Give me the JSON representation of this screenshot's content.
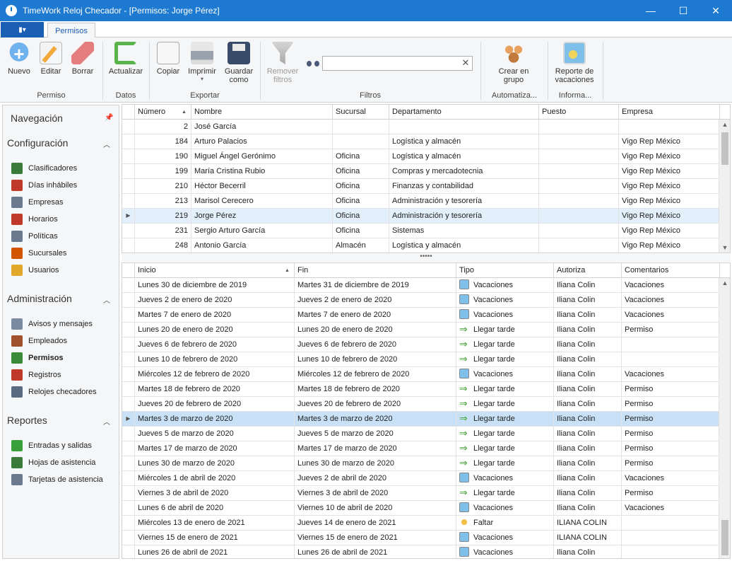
{
  "window": {
    "title": "TimeWork Reloj Checador - [Permisos: Jorge Pérez]",
    "minimize": "—",
    "maximize": "☐",
    "close": "✕"
  },
  "ribbon": {
    "app_menu_glyph": "▮▾",
    "tab": "Permisos",
    "buttons": {
      "nuevo": "Nuevo",
      "editar": "Editar",
      "borrar": "Borrar",
      "actualizar": "Actualizar",
      "copiar": "Copiar",
      "imprimir": "Imprimir",
      "guardar_1": "Guardar",
      "guardar_2": "como",
      "remover_1": "Remover",
      "remover_2": "filtros",
      "crear_1": "Crear en",
      "crear_2": "grupo",
      "reporte_1": "Reporte de",
      "reporte_2": "vacaciones"
    },
    "groups": {
      "permiso": "Permiso",
      "datos": "Datos",
      "exportar": "Exportar",
      "filtros": "Filtros",
      "automatiza": "Automatiza...",
      "informa": "Informa..."
    },
    "search": {
      "value": "",
      "placeholder": ""
    },
    "imprimir_dropdown": "▾",
    "clear_glyph": "✕"
  },
  "nav": {
    "header": "Navegación",
    "pin_glyph": "📌",
    "chevron": "︿",
    "sections": [
      {
        "title": "Configuración",
        "items": [
          "Clasificadores",
          "Días inhábiles",
          "Empresas",
          "Horarios",
          "Políticas",
          "Sucursales",
          "Usuarios"
        ]
      },
      {
        "title": "Administración",
        "items": [
          "Avisos y mensajes",
          "Empleados",
          "Permisos",
          "Registros",
          "Relojes checadores"
        ]
      },
      {
        "title": "Reportes",
        "items": [
          "Entradas y salidas",
          "Hojas de asistencia",
          "Tarjetas de asistencia"
        ]
      }
    ],
    "icon_colors": {
      "Clasificadores": "#3a7a3a",
      "Días inhábiles": "#c0392b",
      "Empresas": "#6b7a8f",
      "Horarios": "#c0392b",
      "Políticas": "#6b7a8f",
      "Sucursales": "#d35400",
      "Usuarios": "#e0a92b",
      "Avisos y mensajes": "#7a8aa0",
      "Empleados": "#a0522d",
      "Permisos": "#3a8a3a",
      "Registros": "#c0392b",
      "Relojes checadores": "#5a6a80",
      "Entradas y salidas": "#3aa03a",
      "Hojas de asistencia": "#3a7a3a",
      "Tarjetas de asistencia": "#6b7a8f"
    }
  },
  "employees": {
    "columns": [
      "Número",
      "Nombre",
      "Sucursal",
      "Departamento",
      "Puesto",
      "Empresa"
    ],
    "sort_glyph": "▲",
    "rows": [
      [
        "2",
        "José García",
        "",
        "",
        "",
        ""
      ],
      [
        "184",
        "Arturo Palacios",
        "",
        "Logística y almacén",
        "",
        "Vigo Rep México"
      ],
      [
        "190",
        "Miguel Ángel Gerónimo",
        "Oficina",
        "Logística y almacén",
        "",
        "Vigo Rep México"
      ],
      [
        "199",
        "María Cristina Rubio",
        "Oficina",
        "Compras y mercadotecnia",
        "",
        "Vigo Rep México"
      ],
      [
        "210",
        "Héctor Becerril",
        "Oficina",
        "Finanzas y contabilidad",
        "",
        "Vigo Rep México"
      ],
      [
        "213",
        "Marisol Cerecero",
        "Oficina",
        "Administración y tesorería",
        "",
        "Vigo Rep México"
      ],
      [
        "219",
        "Jorge Pérez",
        "Oficina",
        "Administración y tesorería",
        "",
        "Vigo Rep México"
      ],
      [
        "231",
        "Sergio Arturo García",
        "Oficina",
        "Sistemas",
        "",
        "Vigo Rep México"
      ],
      [
        "248",
        "Antonio García",
        "Almacén",
        "Logística y almacén",
        "",
        "Vigo Rep México"
      ]
    ],
    "selected_index": 6
  },
  "splitter_glyph": "•••••",
  "permissions": {
    "columns": [
      "Inicio",
      "Fin",
      "Tipo",
      "Autoriza",
      "Comentarios"
    ],
    "sort_glyph": "▲",
    "row_pointer": "▶",
    "scroll_up": "▲",
    "scroll_down": "▼",
    "rows": [
      [
        "Lunes 30 de diciembre de 2019",
        "Martes 31 de diciembre de 2019",
        "Vacaciones",
        "Iliana Colin",
        "Vacaciones"
      ],
      [
        "Jueves 2 de enero de 2020",
        "Jueves 2 de enero de 2020",
        "Vacaciones",
        "Iliana Colin",
        "Vacaciones"
      ],
      [
        "Martes 7 de enero de 2020",
        "Martes 7 de enero de 2020",
        "Vacaciones",
        "Iliana Colin",
        "Vacaciones"
      ],
      [
        "Lunes 20 de enero de 2020",
        "Lunes 20 de enero de 2020",
        "Llegar tarde",
        "Iliana Colin",
        "Permiso"
      ],
      [
        "Jueves 6 de febrero de 2020",
        "Jueves 6 de febrero de 2020",
        "Llegar tarde",
        "Iliana Colin",
        ""
      ],
      [
        "Lunes 10 de febrero de 2020",
        "Lunes 10 de febrero de 2020",
        "Llegar tarde",
        "Iliana Colin",
        ""
      ],
      [
        "Miércoles 12 de febrero de 2020",
        "Miércoles 12 de febrero de 2020",
        "Vacaciones",
        "Iliana Colin",
        "Vacaciones"
      ],
      [
        "Martes 18 de febrero de 2020",
        "Martes 18 de febrero de 2020",
        "Llegar tarde",
        "Iliana Colin",
        "Permiso"
      ],
      [
        "Jueves 20 de febrero de 2020",
        "Jueves 20 de febrero de 2020",
        "Llegar tarde",
        "Iliana Colin",
        "Permiso"
      ],
      [
        "Martes 3 de marzo de 2020",
        "Martes 3 de marzo de 2020",
        "Llegar tarde",
        "Iliana Colin",
        "Permiso"
      ],
      [
        "Jueves 5 de marzo de 2020",
        "Jueves 5 de marzo de 2020",
        "Llegar tarde",
        "Iliana Colin",
        "Permiso"
      ],
      [
        "Martes 17 de marzo de 2020",
        "Martes 17 de marzo de 2020",
        "Llegar tarde",
        "Iliana Colin",
        "Permiso"
      ],
      [
        "Lunes 30 de marzo de 2020",
        "Lunes 30 de marzo de 2020",
        "Llegar tarde",
        "Iliana Colin",
        "Permiso"
      ],
      [
        "Miércoles 1 de abril de 2020",
        "Jueves 2 de abril de 2020",
        "Vacaciones",
        "Iliana Colin",
        "Vacaciones"
      ],
      [
        "Viernes 3 de abril de 2020",
        "Viernes 3 de abril de 2020",
        "Llegar tarde",
        "Iliana Colin",
        "Permiso"
      ],
      [
        "Lunes 6 de abril de 2020",
        "Viernes 10 de abril de 2020",
        "Vacaciones",
        "Iliana Colin",
        "Vacaciones"
      ],
      [
        "Miércoles 13 de enero de 2021",
        "Jueves 14 de enero de 2021",
        "Faltar",
        "ILIANA COLIN",
        ""
      ],
      [
        "Viernes 15 de enero de 2021",
        "Viernes 15 de enero de 2021",
        "Vacaciones",
        "ILIANA COLIN",
        ""
      ],
      [
        "Lunes 26 de abril de 2021",
        "Lunes 26 de abril de 2021",
        "Vacaciones",
        "Iliana Colin",
        ""
      ]
    ],
    "selected_index": 9
  },
  "colors": {
    "titlebar": "#1e7ad0",
    "app_menu": "#1b5fb4",
    "selection": "#c9e1f6",
    "selection_light": "#e3f0fb"
  }
}
